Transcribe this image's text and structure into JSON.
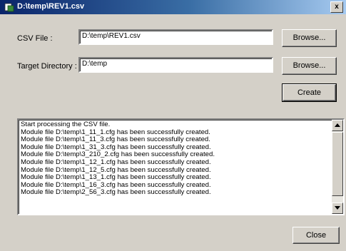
{
  "window": {
    "title": "D:\\temp\\REV1.csv",
    "close_glyph": "x"
  },
  "form": {
    "csv_label": "CSV File :",
    "csv_value": "D:\\temp\\REV1.csv",
    "target_label": "Target Directory :",
    "target_value": "D:\\temp",
    "browse1_label": "Browse...",
    "browse2_label": "Browse...",
    "create_label": "Create",
    "close_label": "Close"
  },
  "log": {
    "lines": [
      "Start processing the CSV file.",
      "Module file D:\\temp\\1_11_1.cfg has been successfully created.",
      "Module file D:\\temp\\1_11_3.cfg has been successfully created.",
      "Module file D:\\temp\\1_31_3.cfg has been successfully created.",
      "Module file D:\\temp\\3_210_2.cfg has been successfully created.",
      "Module file D:\\temp\\1_12_1.cfg has been successfully created.",
      "Module file D:\\temp\\1_12_5.cfg has been successfully created.",
      "Module file D:\\temp\\1_13_1.cfg has been successfully created.",
      "Module file D:\\temp\\1_16_3.cfg has been successfully created.",
      "Module file D:\\temp\\2_56_3.cfg has been successfully created."
    ]
  },
  "icons": {
    "app": "app-icon",
    "scroll_up": "scroll-up-arrow-icon",
    "scroll_down": "scroll-down-arrow-icon"
  },
  "colors": {
    "titlebar_start": "#0a246a",
    "titlebar_end": "#a6caf0",
    "face": "#d4d0c8"
  }
}
